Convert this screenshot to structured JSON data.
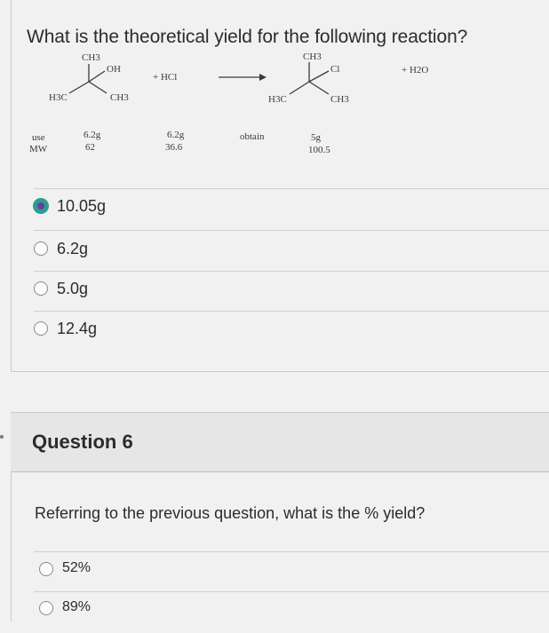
{
  "question5": {
    "text": "What is the theoretical yield for the following reaction?",
    "reaction": {
      "reactant1": {
        "ch3_top": "CH3",
        "oh": "OH",
        "h3c": "H3C",
        "ch3_right": "CH3"
      },
      "plus_hcl": "+ HCl",
      "product": {
        "ch3_top": "CH3",
        "cl": "Cl",
        "h3c": "H3C",
        "ch3_right": "CH3"
      },
      "plus_h2o": "+ H2O",
      "row_labels": [
        "use",
        "MW"
      ],
      "reactant1_values": [
        "6.2g",
        "62"
      ],
      "hcl_values": [
        "6.2g",
        "36.6"
      ],
      "obtain_label": "obtain",
      "product_values": [
        "5g",
        "100.5"
      ]
    },
    "options": [
      {
        "label": "10.05g",
        "selected": true
      },
      {
        "label": "6.2g",
        "selected": false
      },
      {
        "label": "5.0g",
        "selected": false
      },
      {
        "label": "12.4g",
        "selected": false
      }
    ]
  },
  "question6": {
    "title": "Question 6",
    "text": "Referring to the previous question, what is the % yield?",
    "options": [
      {
        "label": "52%",
        "selected": false
      },
      {
        "label": "89%",
        "selected": false
      }
    ]
  },
  "colors": {
    "selected_ring": "#2f9c8f",
    "selected_fill": "#6b3fa0",
    "background": "#f1f1f1"
  }
}
